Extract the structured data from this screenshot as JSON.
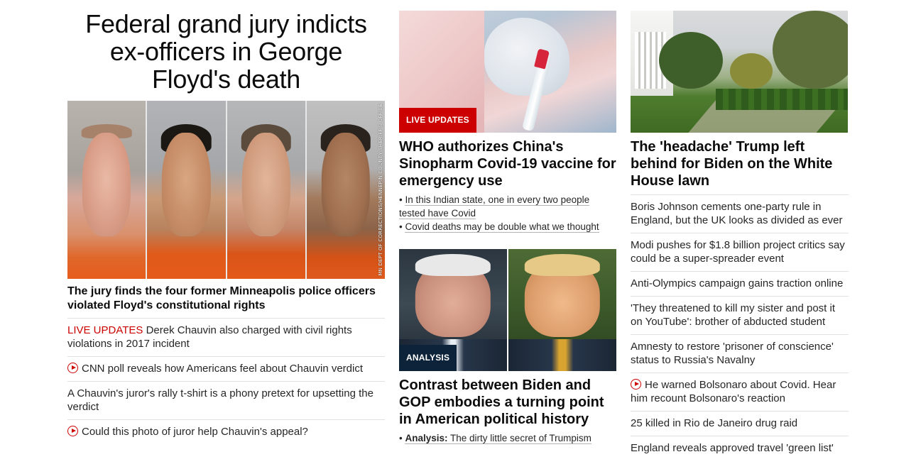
{
  "left": {
    "headline": "Federal grand jury indicts ex-officers in George Floyd's death",
    "photo_credit": "MN DEPT OF CORRECTIONS/HENNEPIN COUNTY SHERIFF'S OFFICE",
    "lead_caption": "The jury finds the four former Minneapolis police officers violated Floyd's constitutional rights",
    "items": [
      {
        "tag": "LIVE UPDATES",
        "text": " Derek Chauvin also charged with civil rights violations in 2017 incident"
      },
      {
        "icon": "play-icon",
        "text": "CNN poll reveals how Americans feel about Chauvin verdict"
      },
      {
        "text": "A Chauvin's juror's rally t-shirt is a phony pretext for upsetting the verdict"
      },
      {
        "icon": "play-icon",
        "text": "Could this photo of juror help Chauvin's appeal?"
      }
    ]
  },
  "middle": {
    "card1": {
      "badge": "LIVE UPDATES",
      "title": "WHO authorizes China's Sinopharm Covid-19 vaccine for emergency use",
      "sublinks": [
        "In this Indian state, one in every two people tested have Covid",
        "Covid deaths may be double what we thought"
      ]
    },
    "card2": {
      "badge": "ANALYSIS",
      "title": "Contrast between Biden and GOP embodies a turning point in American political history",
      "sublink_label": "Analysis:",
      "sublink_text": "The dirty little secret of Trumpism"
    }
  },
  "right": {
    "title": "The 'headache' Trump left behind for Biden on the White House lawn",
    "items": [
      {
        "text": "Boris Johnson cements one-party rule in England, but the UK looks as divided as ever"
      },
      {
        "text": "Modi pushes for $1.8 billion project critics say could be a super-spreader event"
      },
      {
        "text": "Anti-Olympics campaign gains traction online"
      },
      {
        "text": "'They threatened to kill my sister and post it on YouTube': brother of abducted student"
      },
      {
        "text": "Amnesty to restore 'prisoner of conscience' status to Russia's Navalny"
      },
      {
        "icon": "play-icon",
        "text": "He warned Bolsonaro about Covid. Hear him recount Bolsonaro's reaction"
      },
      {
        "text": "25 killed in Rio de Janeiro drug raid"
      },
      {
        "text": "England reveals approved travel 'green list'"
      }
    ]
  },
  "colors": {
    "accent_red": "#cc0000",
    "analysis_navy": "#0c2339",
    "text": "#262626",
    "divider": "#e1e1e1"
  }
}
